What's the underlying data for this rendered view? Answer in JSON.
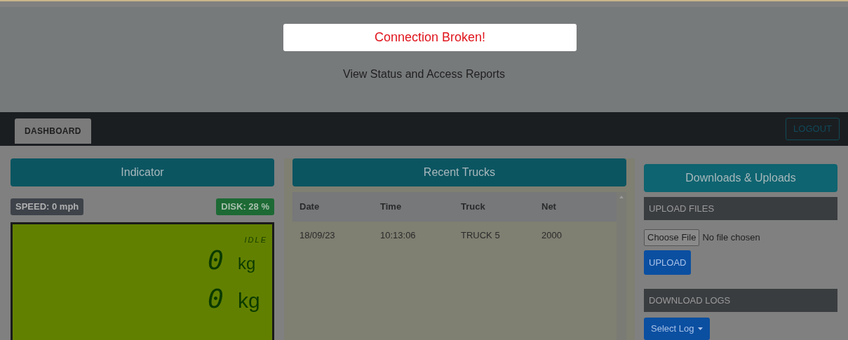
{
  "alert": {
    "message": "Connection Broken!"
  },
  "header": {
    "subtitle": "View Status and Access Reports"
  },
  "navbar": {
    "tabs": [
      {
        "label": "DASHBOARD",
        "selected": true
      }
    ],
    "logout": "LOGOUT"
  },
  "indicator": {
    "title": "Indicator",
    "speed": "SPEED: 0 mph",
    "disk": "DISK: 28 %",
    "status": "IDLE",
    "readings": [
      {
        "value": "0",
        "unit": "kg"
      },
      {
        "value": "0",
        "unit": "kg"
      }
    ]
  },
  "recent_trucks": {
    "title": "Recent Trucks",
    "columns": [
      "Date",
      "Time",
      "Truck",
      "Net"
    ],
    "rows": [
      [
        "18/09/23",
        "10:13:06",
        "TRUCK 5",
        "2000"
      ]
    ]
  },
  "files": {
    "title": "Downloads & Uploads",
    "upload_heading": "UPLOAD FILES",
    "file_button": "Choose File",
    "file_status": "No file chosen",
    "upload_button": "UPLOAD",
    "download_heading": "DOWNLOAD LOGS",
    "select_button": "Select Log"
  }
}
